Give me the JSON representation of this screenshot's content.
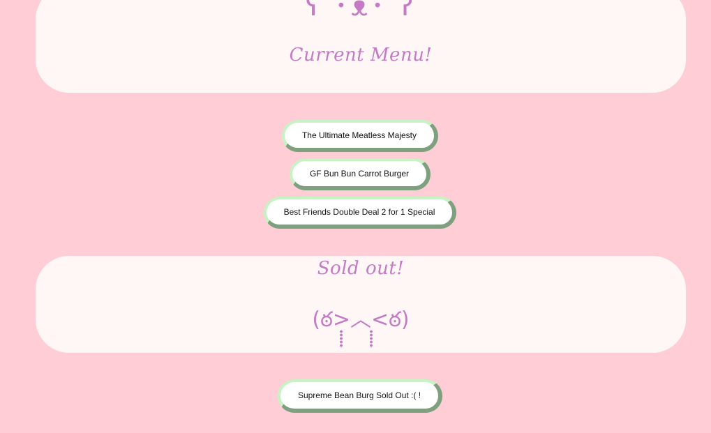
{
  "current_section": {
    "kaomoji": "ʕ ･ᴥ･ ʔ",
    "heading": "Current Menu!"
  },
  "menu_items": [
    {
      "label": "The Ultimate Meatless Majesty"
    },
    {
      "label": "GF Bun Bun Carrot Burger"
    },
    {
      "label": "Best Friends Double Deal 2 for 1 Special"
    }
  ],
  "soldout_section": {
    "heading": "Sold out!",
    "kaomoji": "(ఠ>︿<ఠ)"
  },
  "soldout_items": [
    {
      "label": "Supreme Bean Burg Sold Out :( !"
    }
  ],
  "colors": {
    "background": "#ffcdd6",
    "card": "#fff7f6",
    "accent": "#c47ac4",
    "button_light_border": "#c6f2c4",
    "button_dark_border": "#7ea07e"
  }
}
